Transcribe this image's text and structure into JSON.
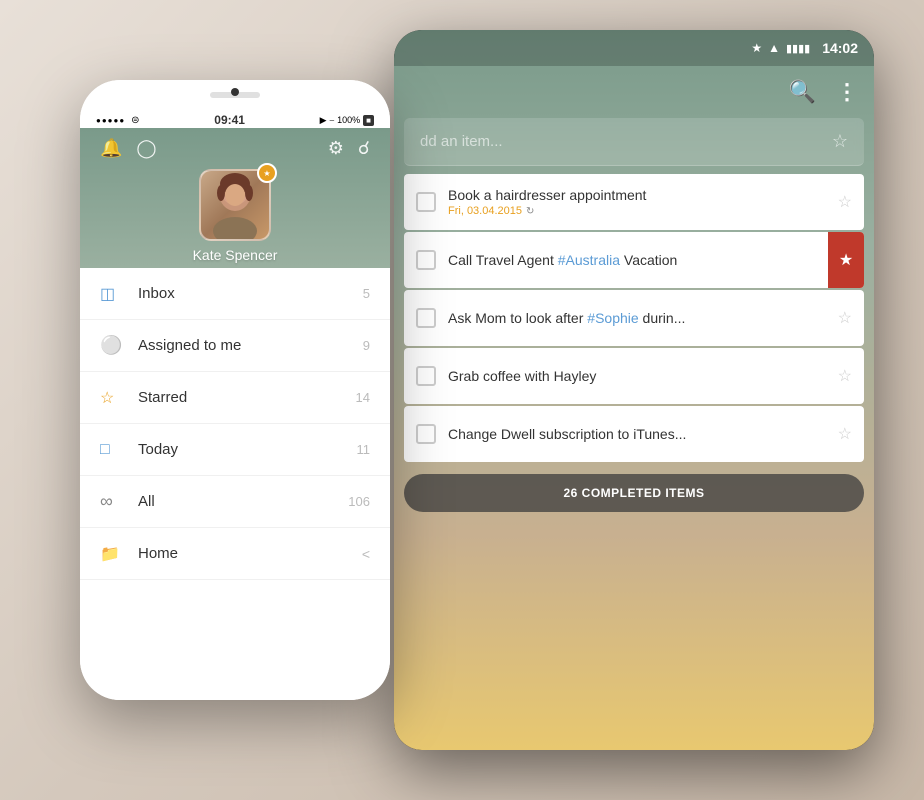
{
  "tablet": {
    "status_bar": {
      "time": "14:02",
      "icons": [
        "bluetooth",
        "wifi",
        "battery"
      ]
    },
    "toolbar": {
      "search_label": "🔍",
      "more_label": "⋮"
    },
    "add_bar": {
      "placeholder": "dd an item...",
      "star_icon": "☆"
    },
    "todo_items": [
      {
        "title": "Book a hairdresser appointment",
        "date": "Fri, 03.04.2015",
        "has_date": true,
        "flagged": false,
        "star": "☆"
      },
      {
        "title_parts": [
          "Call Travel Agent ",
          "#Australia",
          " Vacation"
        ],
        "hashtag_index": 1,
        "has_date": false,
        "flagged": true,
        "flag_icon": "★",
        "star": "★"
      },
      {
        "title_parts": [
          "Ask Mom to look after ",
          "#Sophie",
          " durin..."
        ],
        "hashtag_index": 1,
        "has_date": false,
        "flagged": false,
        "star": "☆"
      },
      {
        "title": "Grab coffee with Hayley",
        "has_date": false,
        "flagged": false,
        "star": "☆"
      },
      {
        "title": "Change Dwell subscription to iTunes...",
        "has_date": false,
        "flagged": false,
        "star": "☆"
      }
    ],
    "completed_banner": {
      "label": "26 COMPLETED ITEMS"
    }
  },
  "phone": {
    "status_bar": {
      "dots": 5,
      "wifi": "wifi",
      "time": "09:41",
      "location": "loc",
      "battery_pct": "100%"
    },
    "header_icons": {
      "bell": "🔔",
      "chat": "💬",
      "gear": "⚙",
      "search": "🔍"
    },
    "profile": {
      "name": "Kate Spencer",
      "badge": "★"
    },
    "nav_items": [
      {
        "icon": "inbox",
        "label": "Inbox",
        "count": "5",
        "has_chevron": false
      },
      {
        "icon": "person",
        "label": "Assigned to me",
        "count": "9",
        "has_chevron": false
      },
      {
        "icon": "star",
        "label": "Starred",
        "count": "14",
        "has_chevron": false
      },
      {
        "icon": "calendar",
        "label": "Today",
        "count": "11",
        "has_chevron": false
      },
      {
        "icon": "infinity",
        "label": "All",
        "count": "106",
        "has_chevron": false
      },
      {
        "icon": "folder",
        "label": "Home",
        "count": "",
        "has_chevron": true
      }
    ]
  }
}
